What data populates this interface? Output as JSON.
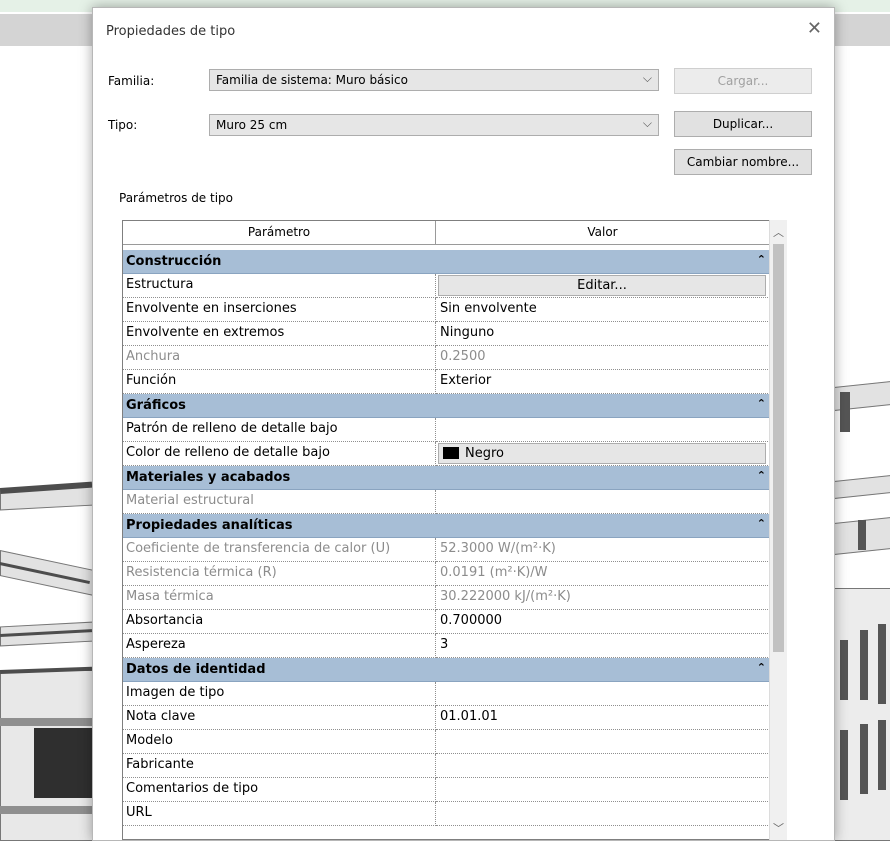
{
  "dialog": {
    "title": "Propiedades de tipo",
    "family_label": "Familia:",
    "family_value": "Familia de sistema: Muro básico",
    "type_label": "Tipo:",
    "type_value": "Muro 25 cm",
    "load_button": "Cargar...",
    "duplicate_button": "Duplicar...",
    "rename_button": "Cambiar nombre...",
    "section_label": "Parámetros de tipo"
  },
  "grid": {
    "header_param": "Parámetro",
    "header_value": "Valor",
    "header_eq": "=",
    "categories": {
      "construccion": "Construcción",
      "graficos": "Gráficos",
      "materiales": "Materiales y acabados",
      "analiticas": "Propiedades analíticas",
      "identidad": "Datos de identidad"
    },
    "rows": {
      "estructura": {
        "param": "Estructura",
        "value": "Editar..."
      },
      "env_ins": {
        "param": "Envolvente en inserciones",
        "value": "Sin envolvente"
      },
      "env_ext": {
        "param": "Envolvente en extremos",
        "value": "Ninguno"
      },
      "anchura": {
        "param": "Anchura",
        "value": "0.2500"
      },
      "funcion": {
        "param": "Función",
        "value": "Exterior"
      },
      "patron": {
        "param": "Patrón de relleno de detalle bajo",
        "value": ""
      },
      "color": {
        "param": "Color de relleno de detalle bajo",
        "value": "Negro"
      },
      "material": {
        "param": "Material estructural",
        "value": ""
      },
      "coef": {
        "param": "Coeficiente de transferencia de calor (U)",
        "value": "52.3000 W/(m²·K)"
      },
      "resist": {
        "param": "Resistencia térmica (R)",
        "value": "0.0191 (m²·K)/W"
      },
      "masa": {
        "param": "Masa térmica",
        "value": "30.222000 kJ/(m²·K)"
      },
      "absort": {
        "param": "Absortancia",
        "value": "0.700000"
      },
      "aspereza": {
        "param": "Aspereza",
        "value": "3"
      },
      "imagen": {
        "param": "Imagen de tipo",
        "value": ""
      },
      "nota": {
        "param": "Nota clave",
        "value": "01.01.01"
      },
      "modelo": {
        "param": "Modelo",
        "value": ""
      },
      "fabricante": {
        "param": "Fabricante",
        "value": ""
      },
      "comentarios": {
        "param": "Comentarios de tipo",
        "value": ""
      },
      "url": {
        "param": "URL",
        "value": ""
      }
    }
  },
  "colors": {
    "category_band": "#a7bed6",
    "swatch": "#000000"
  }
}
